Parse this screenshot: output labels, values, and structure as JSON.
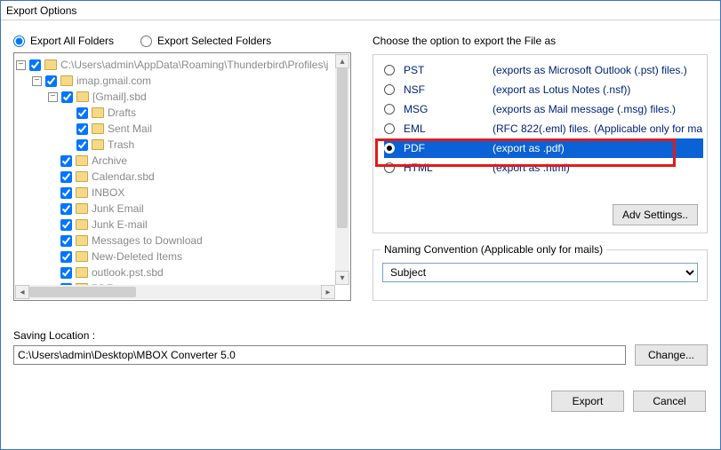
{
  "window": {
    "title": "Export Options"
  },
  "exportMode": {
    "all": "Export All Folders",
    "selected": "Export Selected Folders",
    "chosen": "all"
  },
  "rightHeading": "Choose the option to export the File as",
  "tree": {
    "root": {
      "expand": "−",
      "label": "C:\\Users\\admin\\AppData\\Roaming\\Thunderbird\\Profiles\\j",
      "checked": true
    },
    "account": {
      "expand": "−",
      "label": "imap.gmail.com",
      "checked": true
    },
    "gmail": {
      "expand": "−",
      "label": "[Gmail].sbd",
      "checked": true,
      "children": [
        {
          "label": "Drafts",
          "checked": true
        },
        {
          "label": "Sent Mail",
          "checked": true
        },
        {
          "label": "Trash",
          "checked": true
        }
      ]
    },
    "rest": [
      {
        "label": "Archive",
        "checked": true
      },
      {
        "label": "Calendar.sbd",
        "checked": true
      },
      {
        "label": "INBOX",
        "checked": true
      },
      {
        "label": "Junk Email",
        "checked": true
      },
      {
        "label": "Junk E-mail",
        "checked": true
      },
      {
        "label": "Messages to Download",
        "checked": true
      },
      {
        "label": "New-Deleted Items",
        "checked": true
      },
      {
        "label": "outlook.pst.sbd",
        "checked": true
      },
      {
        "label": "PDF",
        "checked": true
      }
    ]
  },
  "formats": [
    {
      "name": "PST",
      "desc": "(exports as Microsoft Outlook (.pst) files.)",
      "selected": false
    },
    {
      "name": "NSF",
      "desc": "(export as Lotus Notes (.nsf))",
      "selected": false
    },
    {
      "name": "MSG",
      "desc": "(exports as Mail message (.msg) files.)",
      "selected": false
    },
    {
      "name": "EML",
      "desc": "(RFC 822(.eml) files. (Applicable only for ma",
      "selected": false
    },
    {
      "name": "PDF",
      "desc": "(export as .pdf)",
      "selected": true
    },
    {
      "name": "HTML",
      "desc": "(export as .html)",
      "selected": false
    }
  ],
  "advSettings": "Adv Settings..",
  "naming": {
    "legend": "Naming Convention (Applicable only for mails)",
    "value": "Subject"
  },
  "saving": {
    "label": "Saving Location :",
    "value": "C:\\Users\\admin\\Desktop\\MBOX Converter 5.0",
    "changeBtn": "Change..."
  },
  "buttons": {
    "export": "Export",
    "cancel": "Cancel"
  }
}
